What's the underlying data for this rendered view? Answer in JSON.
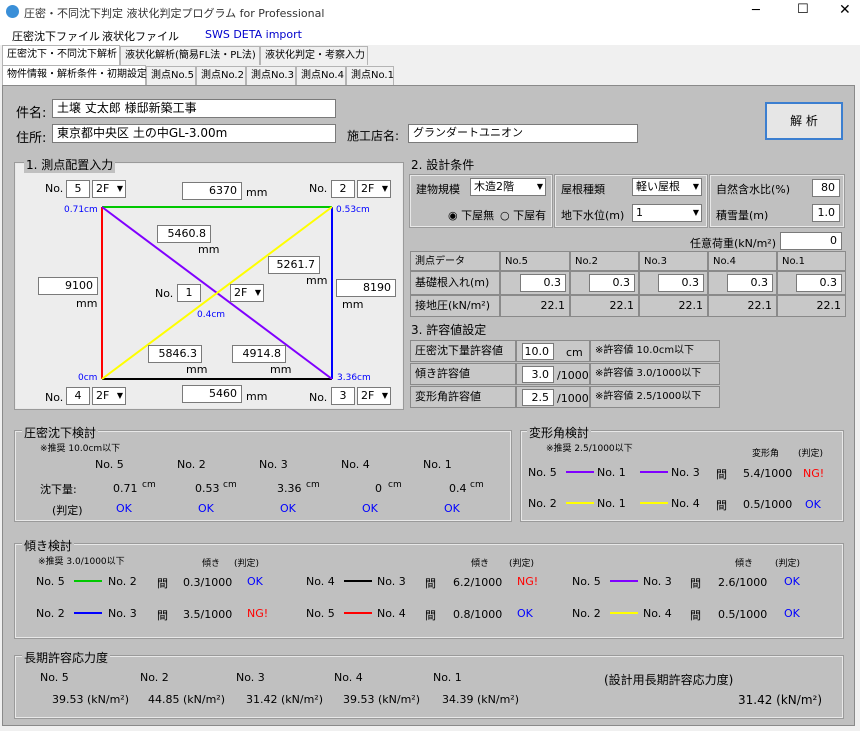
{
  "window": {
    "title": "圧密・不同沈下判定 液状化判定プログラム for Professional"
  },
  "menu": {
    "items": [
      "圧密沈下ファイル",
      "液状化ファイル",
      "SWS DETA import"
    ]
  },
  "tabs_main": [
    "圧密沈下・不同沈下解析",
    "液状化解析(簡易FL法・PL法)",
    "液状化判定・考察入力"
  ],
  "tabs_sub": [
    "物件情報・解析条件・初期設定",
    "測点No.5",
    "測点No.2",
    "測点No.3",
    "測点No.4",
    "測点No.1"
  ],
  "project": {
    "name_label": "件名:",
    "name": "土壌 丈太郎 様邸新築工事",
    "address_label": "住所:",
    "address": "東京都中央区 土の中GL-3.00m",
    "builder_label": "施工店名:",
    "builder": "グランダートユニオン",
    "analyze_button": "解 析"
  },
  "section1": {
    "title": "1. 測点配置入力",
    "no_label": "No.",
    "p_tl": "5",
    "p_tr": "2",
    "p_c": "1",
    "p_bl": "4",
    "p_br": "3",
    "floor": "2F",
    "top_dist": "6370",
    "right_dist": "8190",
    "left_dist": "9100",
    "bottom_dist": "5460",
    "diag1": "5460.8",
    "diag2": "5261.7",
    "diag3": "5846.3",
    "diag4": "4914.8",
    "unit": "mm",
    "s_tl": "0.71cm",
    "s_tr": "0.53cm",
    "s_c": "0.4cm",
    "s_bl": "0cm",
    "s_br": "3.36cm"
  },
  "section2": {
    "title": "2. 設計条件",
    "building_label": "建物規模",
    "building": "木造2階",
    "roof_label": "屋根種類",
    "roof": "軽い屋根",
    "moisture_label": "自然含水比(%)",
    "moisture": "80",
    "radio1": "下屋無",
    "radio2": "下屋有",
    "gw_label": "地下水位(m)",
    "gw": "1",
    "snow_label": "積雪量(m)",
    "snow": "1.0",
    "load_label": "任意荷重(kN/m²)",
    "load": "0"
  },
  "points_table": {
    "header": [
      "測点データ",
      "No.5",
      "No.2",
      "No.3",
      "No.4",
      "No.1"
    ],
    "row1_label": "基礎根入れ(m)",
    "row1": [
      "0.3",
      "0.3",
      "0.3",
      "0.3",
      "0.3"
    ],
    "row2_label": "接地圧(kN/m²)",
    "row2": [
      "22.1",
      "22.1",
      "22.1",
      "22.1",
      "22.1"
    ]
  },
  "section3": {
    "title": "3. 許容値設定",
    "r1_label": "圧密沈下量許容値",
    "r1": "10.0",
    "r1_unit": "cm",
    "r1_note": "※許容値 10.0cm以下",
    "r2_label": "傾き許容値",
    "r2": "3.0",
    "r2_unit": "/1000",
    "r2_note": "※許容値 3.0/1000以下",
    "r3_label": "変形角許容値",
    "r3": "2.5",
    "r3_unit": "/1000",
    "r3_note": "※許容値 2.5/1000以下"
  },
  "settle": {
    "title": "圧密沈下検討",
    "rec": "※推奨 10.0cm以下",
    "nos": [
      "No. 5",
      "No. 2",
      "No. 3",
      "No. 4",
      "No. 1"
    ],
    "amount_label": "沈下量:",
    "amounts": [
      "0.71",
      "0.53",
      "3.36",
      "0",
      "0.4"
    ],
    "unit": "cm",
    "judge_label": "(判定)",
    "judges": [
      "OK",
      "OK",
      "OK",
      "OK",
      "OK"
    ]
  },
  "deform": {
    "title": "変形角検討",
    "rec": "※推奨 2.5/1000以下",
    "col1": "変形角",
    "col2": "(判定)",
    "r1": [
      "No. 5",
      "No. 1",
      "No. 3",
      "間",
      "5.4/1000",
      "NG!"
    ],
    "r2": [
      "No. 2",
      "No. 1",
      "No. 4",
      "間",
      "0.5/1000",
      "OK"
    ]
  },
  "tilt": {
    "title": "傾き検討",
    "rec": "※推奨 3.0/1000以下",
    "col1": "傾き",
    "col2": "(判定)",
    "rows": [
      [
        "No. 5",
        "No. 2",
        "間",
        "0.3/1000",
        "OK"
      ],
      [
        "No. 4",
        "No. 3",
        "間",
        "6.2/1000",
        "NG!"
      ],
      [
        "No. 5",
        "No. 3",
        "間",
        "2.6/1000",
        "OK"
      ],
      [
        "No. 2",
        "No. 3",
        "間",
        "3.5/1000",
        "NG!"
      ],
      [
        "No. 5",
        "No. 4",
        "間",
        "0.8/1000",
        "OK"
      ],
      [
        "No. 2",
        "No. 4",
        "間",
        "0.5/1000",
        "OK"
      ]
    ]
  },
  "bearing": {
    "title": "長期許容応力度",
    "nos": [
      "No. 5",
      "No. 2",
      "No. 3",
      "No. 4",
      "No. 1"
    ],
    "values": [
      "39.53 (kN/m²)",
      "44.85 (kN/m²)",
      "31.42 (kN/m²)",
      "39.53 (kN/m²)",
      "34.39 (kN/m²)"
    ],
    "design_label": "(設計用長期許容応力度)",
    "design": "31.42 (kN/m²)"
  },
  "colors": {
    "green": "#00c800",
    "blue": "#0000ff",
    "red": "#ff0000",
    "yellow": "#ffff00",
    "purple": "#8000ff",
    "black": "#000000"
  }
}
